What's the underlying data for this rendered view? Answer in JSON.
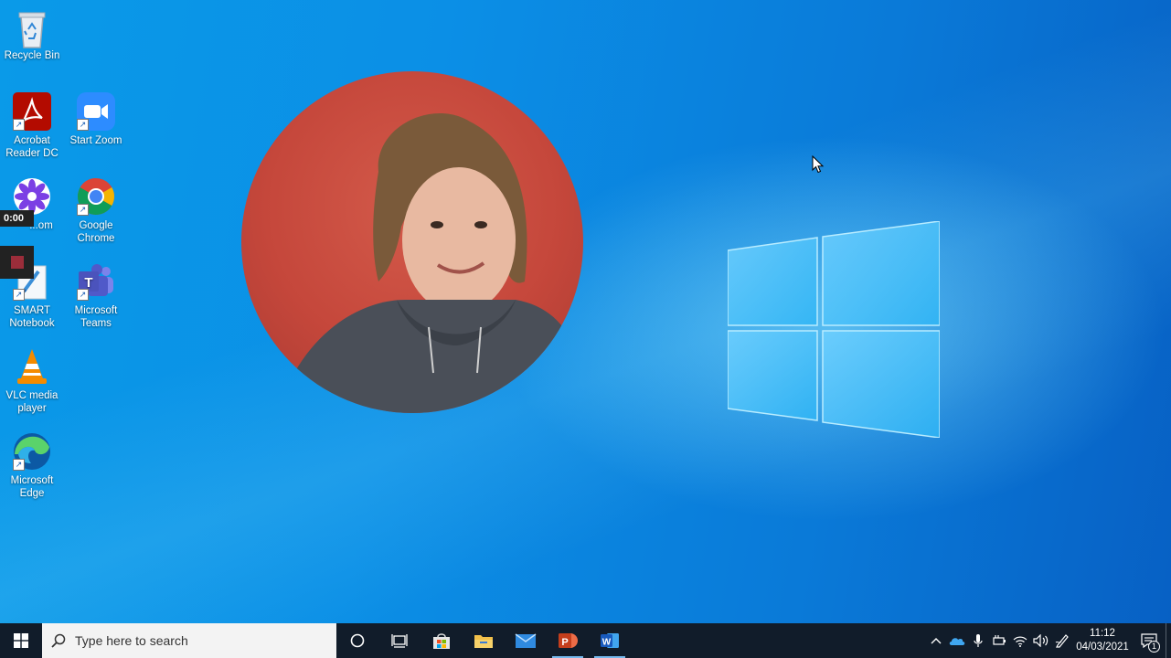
{
  "desktop": {
    "icons": [
      {
        "label": "Recycle Bin"
      },
      {
        "label": "Acrobat Reader DC"
      },
      {
        "label": "Start Zoom"
      },
      {
        "label": "...om"
      },
      {
        "label": "Google Chrome"
      },
      {
        "label": "SMART Notebook"
      },
      {
        "label": "Microsoft Teams"
      },
      {
        "label": "VLC media player"
      },
      {
        "label": "Microsoft Edge"
      }
    ]
  },
  "recorder": {
    "timer": "0:00"
  },
  "taskbar": {
    "search_placeholder": "Type here to search",
    "clock_time": "11:12",
    "clock_date": "04/03/2021",
    "notification_count": "1"
  },
  "colors": {
    "taskbar_bg": "#111c2a",
    "accent": "#76b9ed"
  }
}
